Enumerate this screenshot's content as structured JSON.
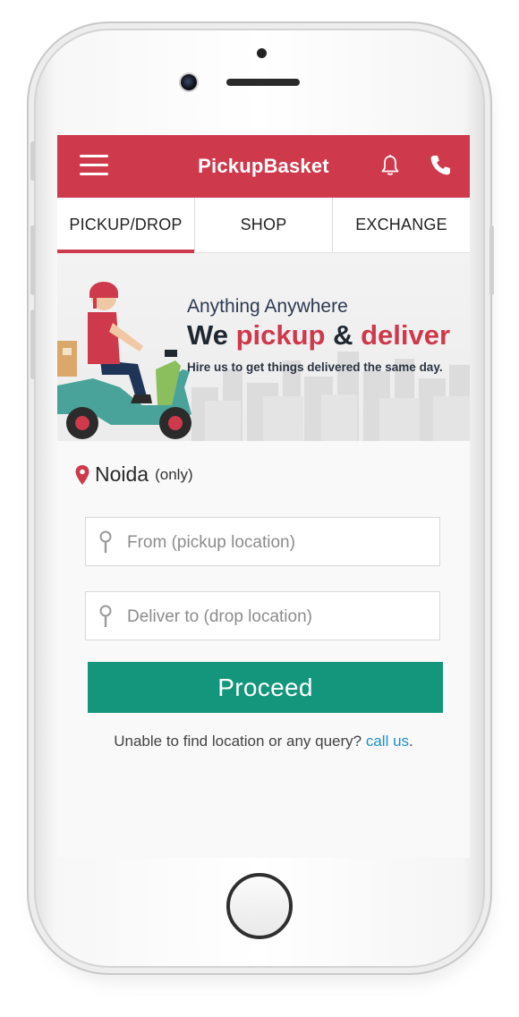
{
  "header": {
    "title": "PickupBasket",
    "icons": {
      "menu": "hamburger-menu-icon",
      "notifications": "bell-icon",
      "call": "phone-icon"
    },
    "color": "#cf394c"
  },
  "tabs": [
    {
      "label": "PICKUP/DROP",
      "active": true
    },
    {
      "label": "SHOP",
      "active": false
    },
    {
      "label": "EXCHANGE",
      "active": false
    }
  ],
  "banner": {
    "line1": "Anything Anywhere",
    "line2_part1": "We",
    "line2_part2": "pickup",
    "line2_part3": "&",
    "line2_part4": "deliver",
    "line3": "Hire us to get things delivered the same day."
  },
  "location": {
    "city": "Noida",
    "note": "(only)"
  },
  "form": {
    "from_placeholder": "From (pickup location)",
    "to_placeholder": "Deliver to (drop location)",
    "from_value": "",
    "to_value": ""
  },
  "proceed_label": "Proceed",
  "help": {
    "text": "Unable to find location or any query?",
    "link": "call us",
    "suffix": "."
  },
  "colors": {
    "accent": "#cf394c",
    "button": "#14967c",
    "link": "#1f8fc7"
  }
}
